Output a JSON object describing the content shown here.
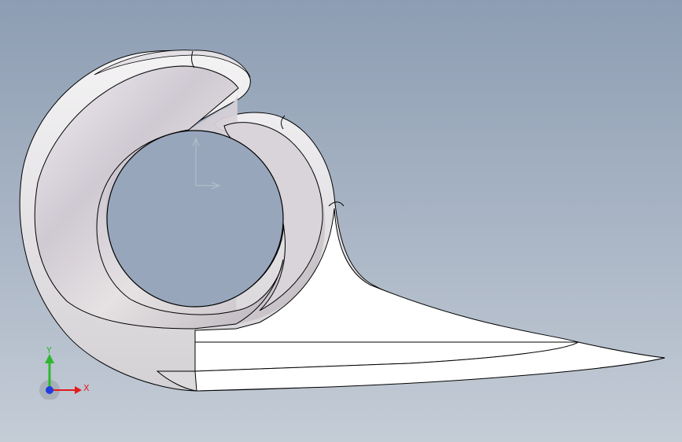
{
  "viewport": {
    "background_top": "#8d9db3",
    "background_bottom": "#c4ccd6"
  },
  "model": {
    "body_color": "#ffffff",
    "edge_color": "#000000",
    "inner_surface_color": "#d9d6dc"
  },
  "triad": {
    "x_label": "X",
    "y_label": "Y",
    "x_color": "#e31b1b",
    "y_color": "#2fb82f",
    "z_color": "#1f3fe0"
  }
}
